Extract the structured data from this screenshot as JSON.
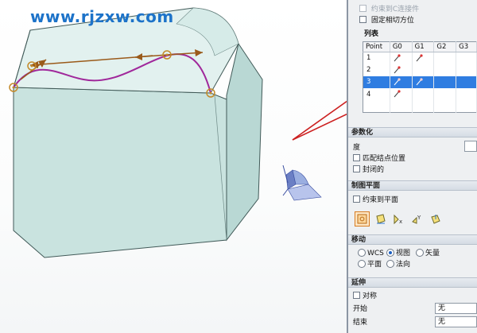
{
  "watermark": "www.rjzxw.com",
  "panel": {
    "constraint_faded_label": "约束到C连接件",
    "fixed_tangent_label": "固定相切方位",
    "list_header": "列表",
    "table": {
      "columns": [
        "Point",
        "G0",
        "G1",
        "G2",
        "G3"
      ],
      "rows": [
        {
          "point": "1",
          "selected": false
        },
        {
          "point": "2",
          "selected": false
        },
        {
          "point": "3",
          "selected": true
        },
        {
          "point": "4",
          "selected": false
        }
      ]
    },
    "params_header": "参数化",
    "degree_label": "度",
    "match_knot_label": "匹配结点位置",
    "closed_label": "封闭的",
    "plane_header": "制图平面",
    "constrain_plane_label": "约束到平面",
    "move_header": "移动",
    "move_options": {
      "wcs": "WCS",
      "view": "视图",
      "vector": "矢量",
      "plane": "平面",
      "normal": "法向",
      "selected": "视图"
    },
    "extend_header": "延伸",
    "symmetric_label": "对称",
    "start_label": "开始",
    "start_value": "无",
    "end_label": "结束",
    "end_value": "无"
  },
  "colors": {
    "accent": "#2f7de1",
    "annotation_arrow": "#cc1f1f",
    "curve": "#a0289b",
    "vector": "#9a5a1a",
    "solid_face": "#cfe5e2"
  },
  "icons": {
    "g1_constraint": "constraint-pin-icon",
    "plane_tools": [
      "view-plane-icon",
      "xc-plane-icon",
      "yc-plane-icon",
      "zc-plane-icon",
      "custom-plane-icon"
    ],
    "triad": "view-triad-icon"
  }
}
